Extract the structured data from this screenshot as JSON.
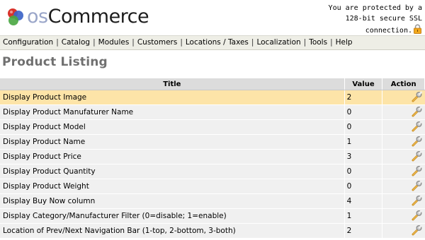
{
  "header": {
    "logo": {
      "prefix": "os",
      "suffix": "Commerce"
    },
    "ssl_line1": "You are protected by a",
    "ssl_line2": "128-bit secure SSL",
    "ssl_line3": "connection.",
    "lock_icon": "lock-icon"
  },
  "menu": {
    "items": [
      "Configuration",
      "Catalog",
      "Modules",
      "Customers",
      "Locations / Taxes",
      "Localization",
      "Tools",
      "Help"
    ],
    "separator": "|"
  },
  "page": {
    "title": "Product Listing"
  },
  "table": {
    "headers": {
      "title": "Title",
      "value": "Value",
      "action": "Action"
    },
    "action_icon": "wrench-icon",
    "selected_row": 0,
    "rows": [
      {
        "title": "Display Product Image",
        "value": "2"
      },
      {
        "title": "Display Product Manufaturer Name",
        "value": "0"
      },
      {
        "title": "Display Product Model",
        "value": "0"
      },
      {
        "title": "Display Product Name",
        "value": "1"
      },
      {
        "title": "Display Product Price",
        "value": "3"
      },
      {
        "title": "Display Product Quantity",
        "value": "0"
      },
      {
        "title": "Display Product Weight",
        "value": "0"
      },
      {
        "title": "Display Buy Now column",
        "value": "4"
      },
      {
        "title": "Display Category/Manufacturer Filter (0=disable; 1=enable)",
        "value": "1"
      },
      {
        "title": "Location of Prev/Next Navigation Bar (1-top, 2-bottom, 3-both)",
        "value": "2"
      }
    ]
  },
  "colors": {
    "menu_bg": "#eeeee6",
    "row_bg": "#f0f0f0",
    "selected_bg": "#fde4a8",
    "header_bg": "#dcdcdc",
    "title_color": "#707070"
  }
}
